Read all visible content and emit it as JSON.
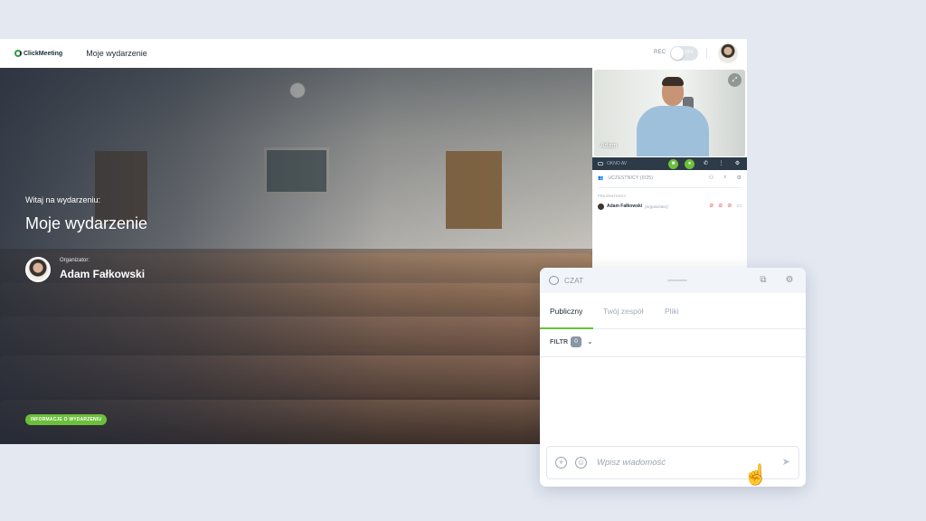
{
  "header": {
    "logo_text": "ClickMeeting",
    "event_name": "Moje wydarzenie",
    "rec_label": "REC",
    "rec_toggle_state": "OFF"
  },
  "hero": {
    "welcome": "Witaj na wydarzeniu:",
    "title": "Moje wydarzenie",
    "organizer_label": "Organizator:",
    "organizer_name": "Adam Fałkowski",
    "info_button": "INFORMACJE O WYDARZENIU"
  },
  "video": {
    "participant_name": "Adam",
    "av_label": "OKNO AV"
  },
  "participants": {
    "header": "UCZESTNICY (0/25)",
    "presenters_label": "PREZENTERZY",
    "presenter_name": "Adam Fałkowski",
    "presenter_role": "(organizator)"
  },
  "chat": {
    "title": "CZAT",
    "tabs": [
      "Publiczny",
      "Twój zespół",
      "Pliki"
    ],
    "active_tab": "Publiczny",
    "filter_label": "FILTR",
    "filter_count": "0",
    "input_placeholder": "Wpisz wiadomość"
  },
  "colors": {
    "accent": "#6cbf3b",
    "dark_bar": "#2d3a48",
    "background": "#e3e8f1"
  },
  "icons": [
    "logo-icon",
    "camera-icon",
    "mic-icon",
    "phone-icon",
    "more-icon",
    "settings-icon",
    "pin-icon",
    "chat-icon",
    "popout-icon",
    "gear-icon",
    "add-icon",
    "emoji-icon",
    "send-icon",
    "chevron-down-icon",
    "hand-cursor-icon"
  ]
}
